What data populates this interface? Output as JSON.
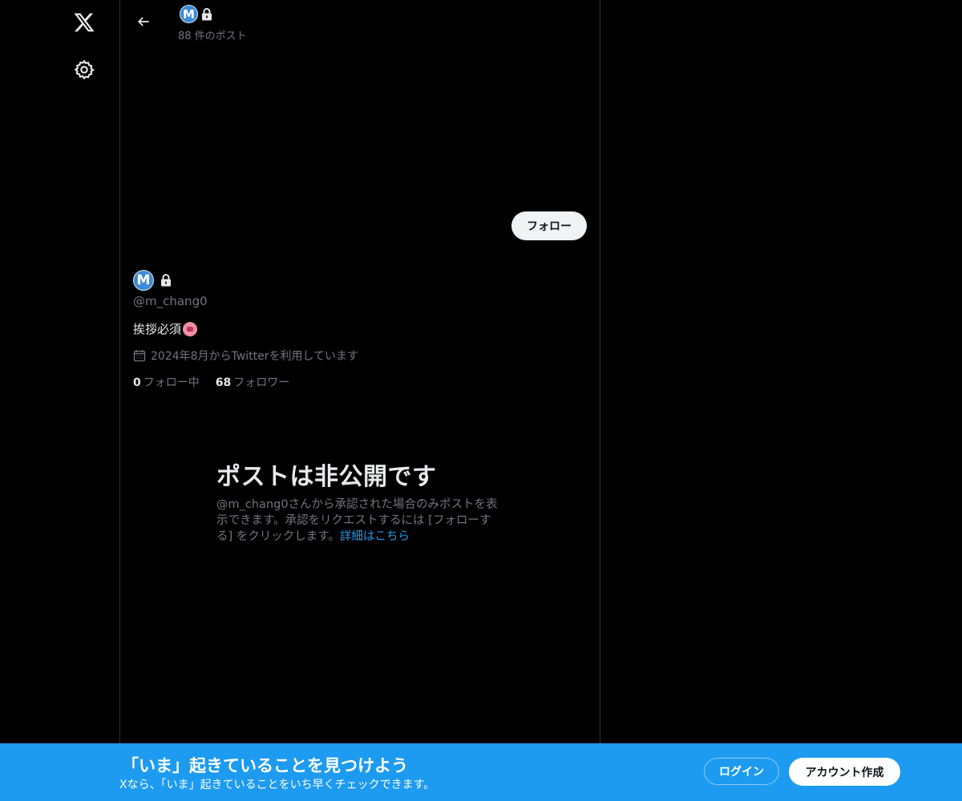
{
  "nav": {
    "logo_icon": "x-logo-icon",
    "settings_icon": "gear-icon"
  },
  "header": {
    "back_icon": "arrow-left-icon",
    "avatar_letter": "M",
    "post_count": "88 件のポスト"
  },
  "profile": {
    "follow_label": "フォロー",
    "avatar_letter": "M",
    "handle": "@m_chang0",
    "bio": "挨拶必須",
    "bio_emoji": "pink-face-emoji",
    "joined": "2024年8月からTwitterを利用しています",
    "following_count": "0",
    "following_label": "フォロー中",
    "followers_count": "68",
    "followers_label": "フォロワー"
  },
  "private_notice": {
    "title": "ポストは非公開です",
    "description": "@m_chang0さんから承認された場合のみポストを表示できます。承認をリクエストするには [フォローする] をクリックします。",
    "link": "詳細はこちら"
  },
  "banner": {
    "title": "「いま」起きていることを見つけよう",
    "subtitle": "Xなら、「いま」起きていることをいち早くチェックできます。",
    "login_label": "ログイン",
    "signup_label": "アカウント作成"
  },
  "colors": {
    "background": "#000000",
    "accent": "#1d9bf0",
    "secondary_text": "#71767b"
  }
}
